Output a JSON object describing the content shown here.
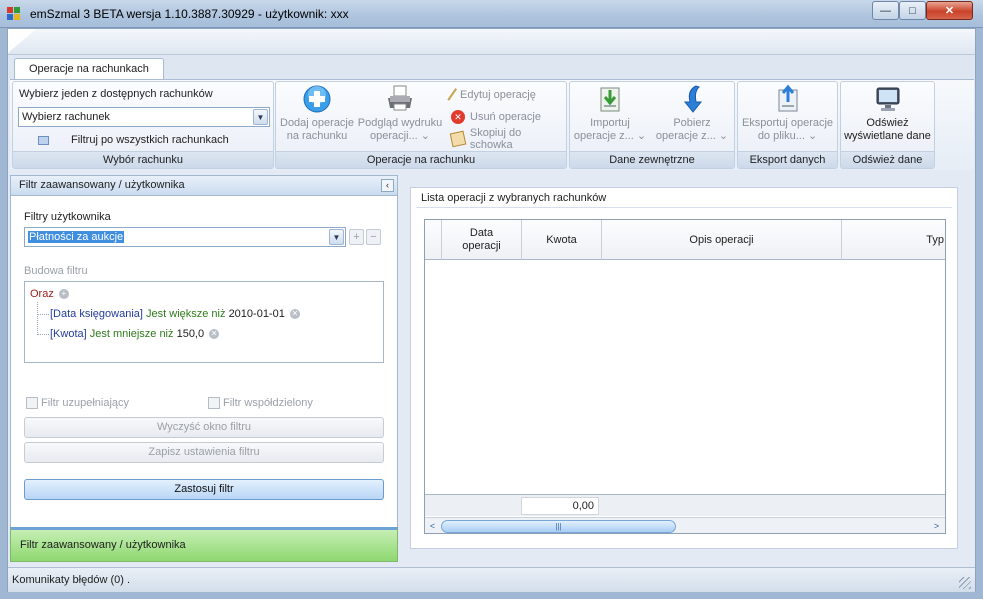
{
  "window": {
    "title": "emSzmal 3 BETA wersja 1.10.3887.30929 - użytkownik: xxx",
    "min_glyph": "—",
    "max_glyph": "□",
    "close_glyph": "✕"
  },
  "ribbon": {
    "tab": "Operacje na rachunkach",
    "account_group": {
      "prompt": "Wybierz jeden z dostępnych rachunków",
      "select_value": "Wybierz rachunek",
      "filter_all": "Filtruj po wszystkich rachunkach",
      "label": "Wybór rachunku"
    },
    "ops_group": {
      "add": [
        "Dodaj operacje",
        "na rachunku"
      ],
      "preview": [
        "Podgląd wydruku",
        "operacji... ⌄"
      ],
      "edit": "Edytuj operację",
      "delete": "Usuń operacje",
      "copy": "Skopiuj do schowka",
      "label": "Operacje na rachunku"
    },
    "external_group": {
      "import": [
        "Importuj",
        "operacje z... ⌄"
      ],
      "fetch": [
        "Pobierz",
        "operacje z... ⌄"
      ],
      "label": "Dane zewnętrzne"
    },
    "export_group": {
      "export": [
        "Eksportuj operacje",
        "do pliku... ⌄"
      ],
      "label": "Eksport danych"
    },
    "refresh_group": {
      "refresh": [
        "Odśwież",
        "wyświetlane dane"
      ],
      "label": "Odśwież dane"
    }
  },
  "filter_panel": {
    "header": "Filtr zaawansowany / użytkownika",
    "collapse_glyph": "‹",
    "user_filters_label": "Filtry użytkownika",
    "user_filter_value": "Płatności za aukcje",
    "add_glyph": "+",
    "remove_glyph": "−",
    "builder_label": "Budowa filtru",
    "tree": {
      "root": "Oraz",
      "cond1": {
        "field": "[Data księgowania]",
        "op": "Jest większe niż",
        "value": "2010-01-01"
      },
      "cond2": {
        "field": "[Kwota]",
        "op": "Jest mniejsze niż",
        "value": "150,0"
      }
    },
    "supplementary": "Filtr uzupełniający",
    "shared": "Filtr współdzielony",
    "clear_btn": "Wyczyść okno filtru",
    "save_btn": "Zapisz ustawienia filtru",
    "apply_btn": "Zastosuj filtr",
    "footer": "Filtr zaawansowany / użytkownika"
  },
  "list": {
    "title": "Lista operacji z wybranych rachunków",
    "columns": [
      "Data operacji",
      "Kwota",
      "Opis operacji",
      "Typ"
    ],
    "sum": "0,00",
    "scroll_left": "<",
    "scroll_right": ">",
    "thumb_grip": "|||"
  },
  "statusbar": {
    "text": "Komunikaty błędów (0)  ."
  },
  "colors": {
    "accent": "#b9d6f5",
    "footer_green": "#8fd870"
  }
}
